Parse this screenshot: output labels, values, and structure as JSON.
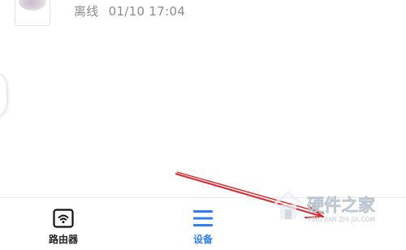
{
  "device": {
    "status": "离线",
    "time": "01/10 17:04"
  },
  "tabbar": {
    "items": [
      {
        "label": "路由器",
        "icon": "wifi-router-icon",
        "active": false
      },
      {
        "label": "设备",
        "icon": "menu-list-icon",
        "active": true
      }
    ],
    "active_color": "#2f7ff5"
  },
  "annotation": {
    "arrow_color": "#d8262b"
  },
  "watermark": {
    "title": "硬件之家",
    "subtitle": "YING JIAN ZHI JIA.COM",
    "icon": "house-logo-icon"
  }
}
